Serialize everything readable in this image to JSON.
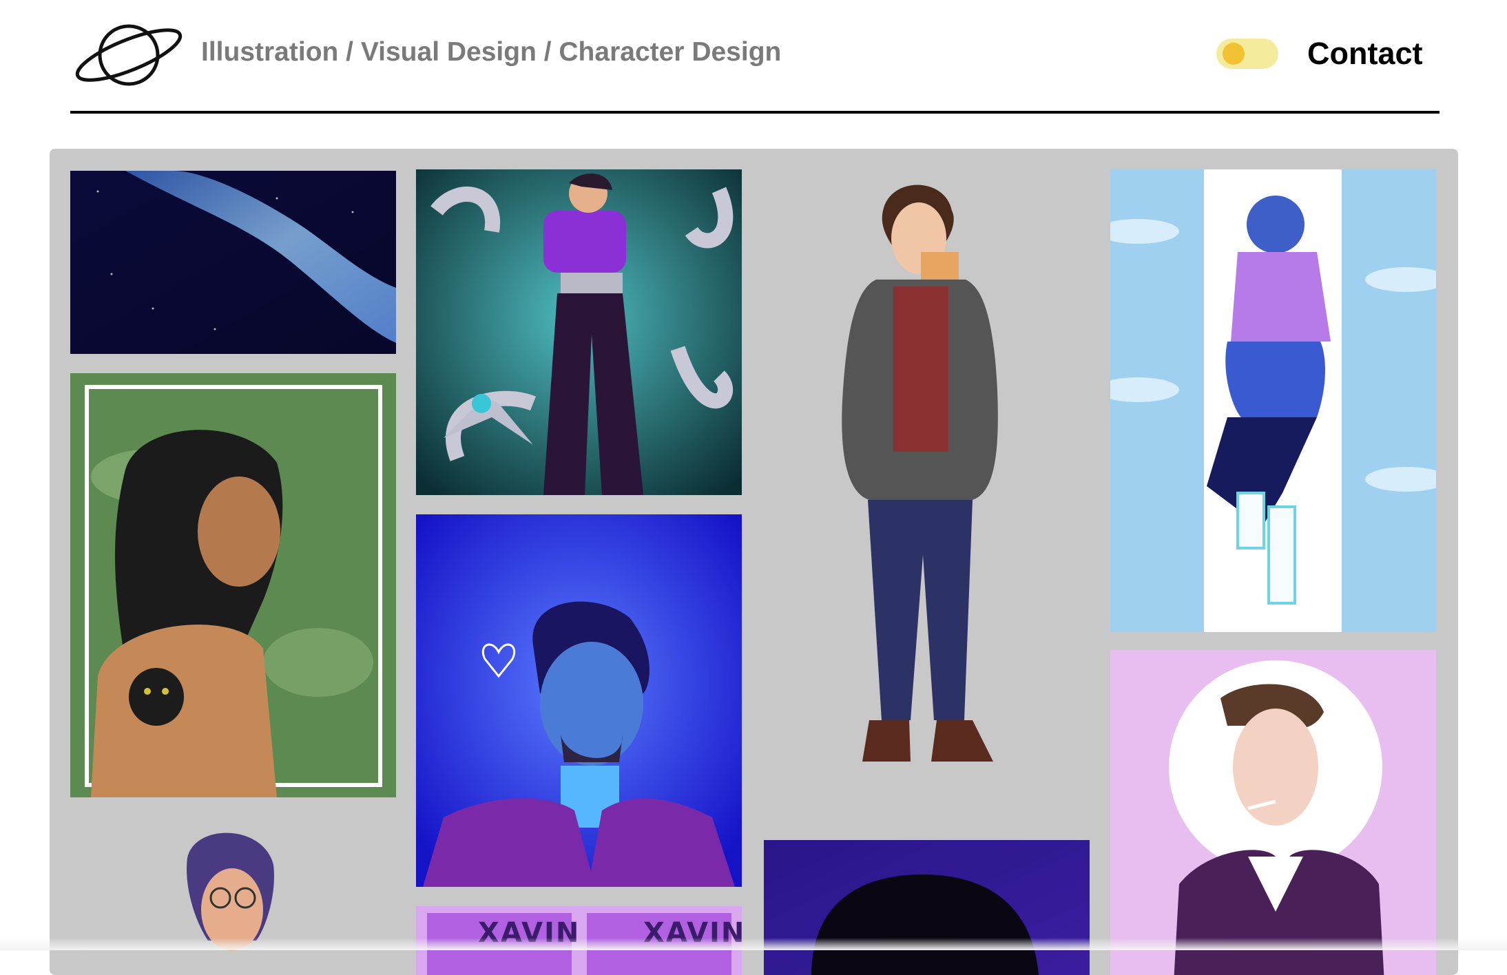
{
  "header": {
    "tagline": "Illustration / Visual Design / Character Design",
    "contact_label": "Contact",
    "logo_icon": "planet-icon",
    "theme_toggle": {
      "state": "off",
      "track_color": "#f4ec9c",
      "knob_color": "#f2c233"
    }
  },
  "gallery": {
    "background_color": "#c8c8c8",
    "items": [
      {
        "name": "galaxy-painting",
        "alt": ""
      },
      {
        "name": "tentacle-villain-illustration",
        "alt": ""
      },
      {
        "name": "man-with-cat-character",
        "alt": ""
      },
      {
        "name": "blue-cyber-character",
        "alt": ""
      },
      {
        "name": "long-haired-man-portrait",
        "alt": ""
      },
      {
        "name": "neon-blue-portrait",
        "alt": ""
      },
      {
        "name": "man-with-cigarette-portrait",
        "alt": ""
      },
      {
        "name": "glasses-character-portrait",
        "alt": ""
      },
      {
        "name": "xavin-banner",
        "alt": ""
      },
      {
        "name": "silhouette-purple-art",
        "alt": ""
      }
    ],
    "xavin_label": "XAVIN"
  }
}
